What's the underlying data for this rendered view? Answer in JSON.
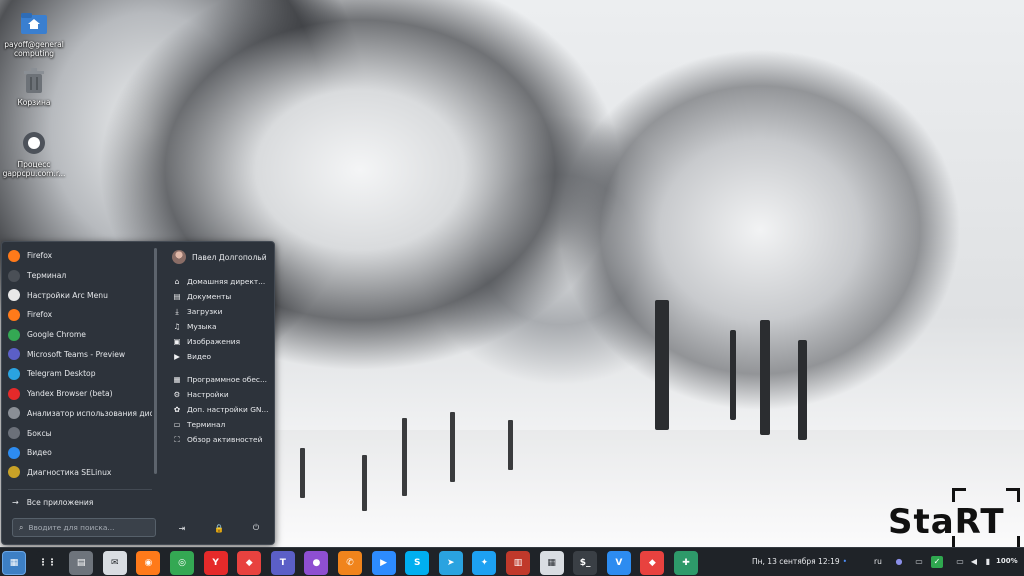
{
  "desktop": {
    "icons": [
      {
        "label": "payoff@general computing",
        "icon": "home-folder-icon"
      },
      {
        "label": "Корзина",
        "icon": "trash-icon"
      },
      {
        "label": "Процесс gappcpu.com.r...",
        "icon": "gear-icon"
      }
    ]
  },
  "arc_menu": {
    "apps": [
      {
        "label": "Firefox",
        "color": "#ff7a1a"
      },
      {
        "label": "Терминал",
        "color": "#4a4f56"
      },
      {
        "label": "Настройки Arc Menu",
        "color": "#e8e8e8"
      },
      {
        "label": "Firefox",
        "color": "#ff7a1a"
      },
      {
        "label": "Google Chrome",
        "color": "#34a853"
      },
      {
        "label": "Microsoft Teams - Preview",
        "color": "#5b5fc7"
      },
      {
        "label": "Telegram Desktop",
        "color": "#2aa3e0"
      },
      {
        "label": "Yandex Browser (beta)",
        "color": "#e52a2a"
      },
      {
        "label": "Анализатор использования дис...",
        "color": "#8a8f96"
      },
      {
        "label": "Боксы",
        "color": "#6b7079"
      },
      {
        "label": "Видео",
        "color": "#2d8cf0"
      },
      {
        "label": "Диагностика SELinux",
        "color": "#c9a227"
      }
    ],
    "all_apps_label": "Все приложения",
    "search_placeholder": "Вводите для поиска...",
    "user_name": "Павел Долгопольй",
    "places": [
      {
        "label": "Домашняя директ...",
        "icon": "⌂"
      },
      {
        "label": "Документы",
        "icon": "▤"
      },
      {
        "label": "Загрузки",
        "icon": "⤓"
      },
      {
        "label": "Музыка",
        "icon": "♫"
      },
      {
        "label": "Изображения",
        "icon": "▣"
      },
      {
        "label": "Видео",
        "icon": "▶"
      }
    ],
    "system": [
      {
        "label": "Программное обес...",
        "icon": "▦"
      },
      {
        "label": "Настройки",
        "icon": "⚙"
      },
      {
        "label": "Доп. настройки GN...",
        "icon": "✿"
      },
      {
        "label": "Терминал",
        "icon": "▭"
      },
      {
        "label": "Обзор активностей",
        "icon": "⛶"
      }
    ],
    "session_icons": {
      "logout": "⇥",
      "lock": "🔒",
      "power": "⏻"
    }
  },
  "taskbar": {
    "clock": "Пн, 13 сентября  12:19",
    "language": "ru",
    "battery": "100%",
    "apps": [
      {
        "name": "activities",
        "color": "#3d7fc4",
        "glyph": "▦"
      },
      {
        "name": "app-grid",
        "color": "#1f2328",
        "glyph": "⋮⋮"
      },
      {
        "name": "files",
        "color": "#6e747c",
        "glyph": "▤"
      },
      {
        "name": "mail",
        "color": "#d9dde2",
        "glyph": "✉"
      },
      {
        "name": "firefox",
        "color": "#ff7a1a",
        "glyph": "◉"
      },
      {
        "name": "chrome",
        "color": "#34a853",
        "glyph": "◎"
      },
      {
        "name": "yandex",
        "color": "#e52a2a",
        "glyph": "Y"
      },
      {
        "name": "anydesk",
        "color": "#e8423f",
        "glyph": "◆"
      },
      {
        "name": "teams",
        "color": "#5b5fc7",
        "glyph": "T"
      },
      {
        "name": "podcast",
        "color": "#8e4fd1",
        "glyph": "●"
      },
      {
        "name": "phone",
        "color": "#f0841c",
        "glyph": "✆"
      },
      {
        "name": "zoom",
        "color": "#2d8cff",
        "glyph": "▶"
      },
      {
        "name": "skype",
        "color": "#00aff0",
        "glyph": "S"
      },
      {
        "name": "telegram",
        "color": "#2aa3e0",
        "glyph": "➤"
      },
      {
        "name": "twitter",
        "color": "#1da1f2",
        "glyph": "✦"
      },
      {
        "name": "reader",
        "color": "#c0392b",
        "glyph": "▥"
      },
      {
        "name": "software",
        "color": "#d9dde2",
        "glyph": "▦"
      },
      {
        "name": "terminal",
        "color": "#3a3f45",
        "glyph": "$_"
      },
      {
        "name": "vscode",
        "color": "#2d8cf0",
        "glyph": "V"
      },
      {
        "name": "anydesk-2",
        "color": "#e8423f",
        "glyph": "◆"
      },
      {
        "name": "tweaks",
        "color": "#2e9a6a",
        "glyph": "✚"
      }
    ]
  },
  "watermark": {
    "text": "StaRT"
  }
}
